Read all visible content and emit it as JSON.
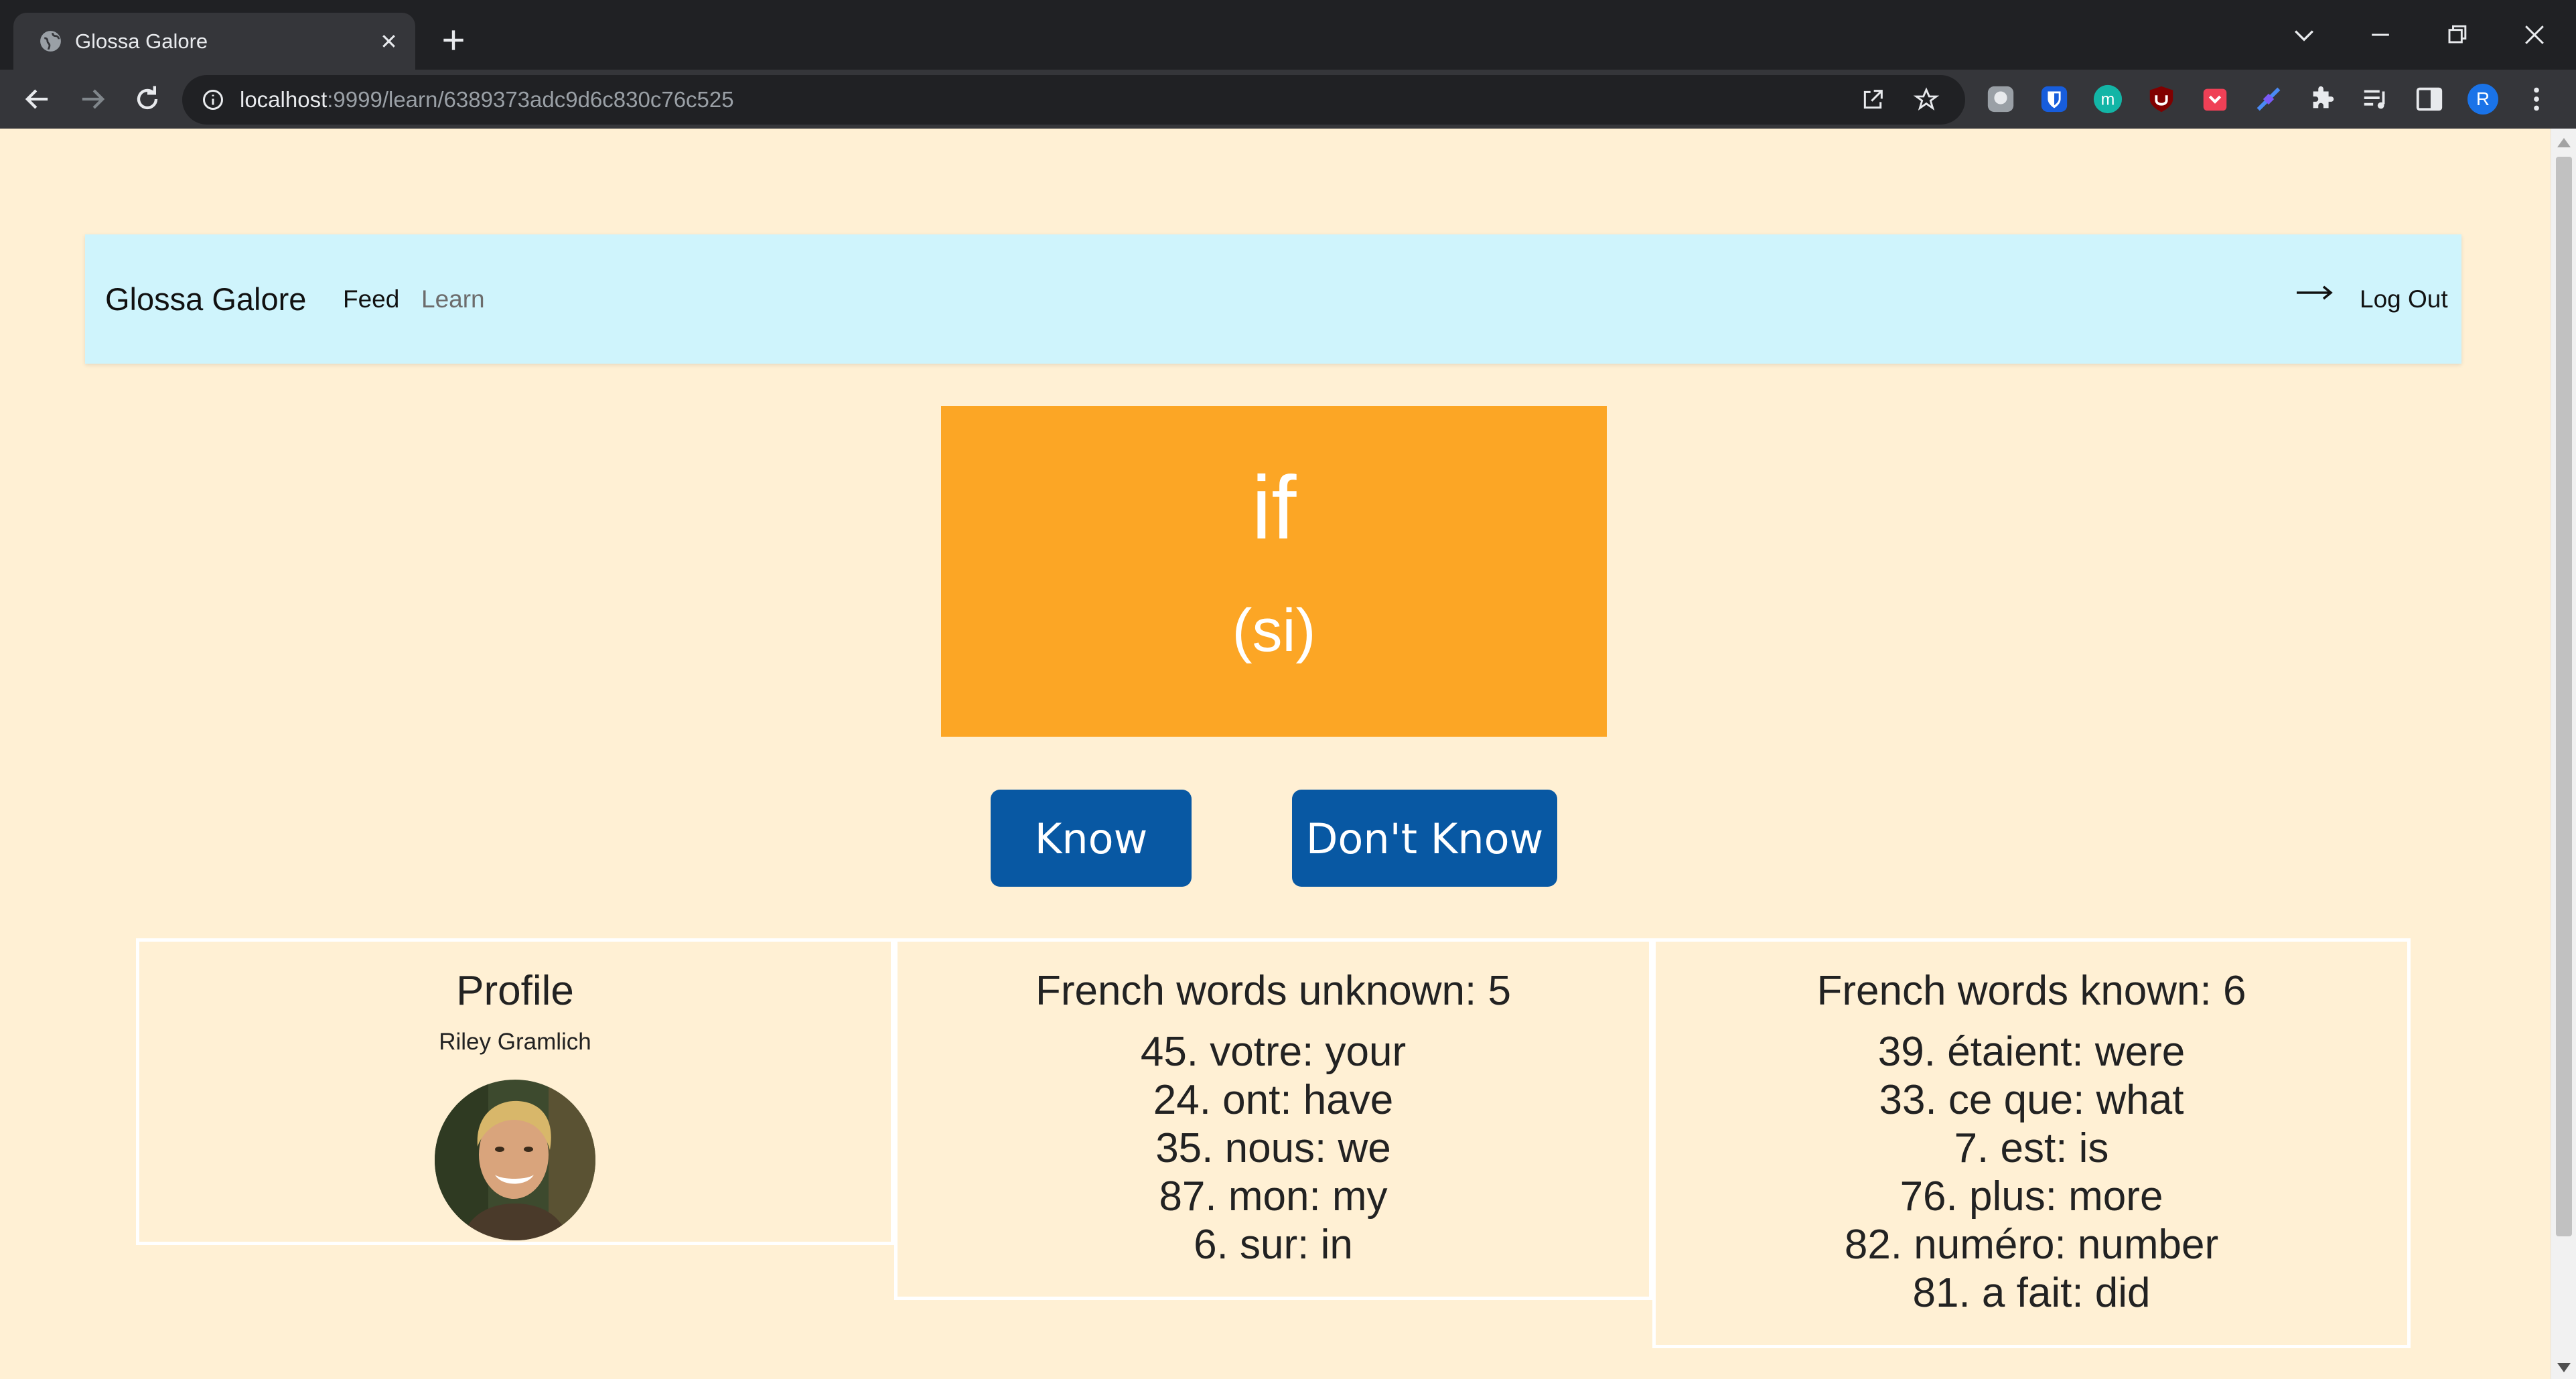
{
  "browser": {
    "tab_title": "Glossa Galore",
    "url_host": "localhost",
    "url_path": ":9999/learn/6389373adc9d6c830c76c525",
    "profile_initial": "R",
    "extension_m_letter": "m"
  },
  "navbar": {
    "brand": "Glossa Galore",
    "links": [
      {
        "label": "Feed"
      },
      {
        "label": "Learn"
      }
    ],
    "logout_label": "Log Out"
  },
  "card": {
    "word": "if",
    "translation": "(si)"
  },
  "actions": {
    "know_label": "Know",
    "dont_know_label": "Don't Know"
  },
  "profile": {
    "title": "Profile",
    "name": "Riley Gramlich"
  },
  "unknown": {
    "title": "French words unknown: 5",
    "items": [
      "45. votre: your",
      "24. ont: have",
      "35. nous: we",
      "87. mon: my",
      "6. sur: in"
    ]
  },
  "known": {
    "title": "French words known: 6",
    "items": [
      "39. étaient: were",
      "33. ce que: what",
      "7. est: is",
      "76. plus: more",
      "82. numéro: number",
      "81. a fait: did"
    ]
  },
  "colors": {
    "page_background": "#fff0d4",
    "navbar_background": "#cff4fc",
    "card_background": "#fca625",
    "button_background": "#0858a3"
  }
}
